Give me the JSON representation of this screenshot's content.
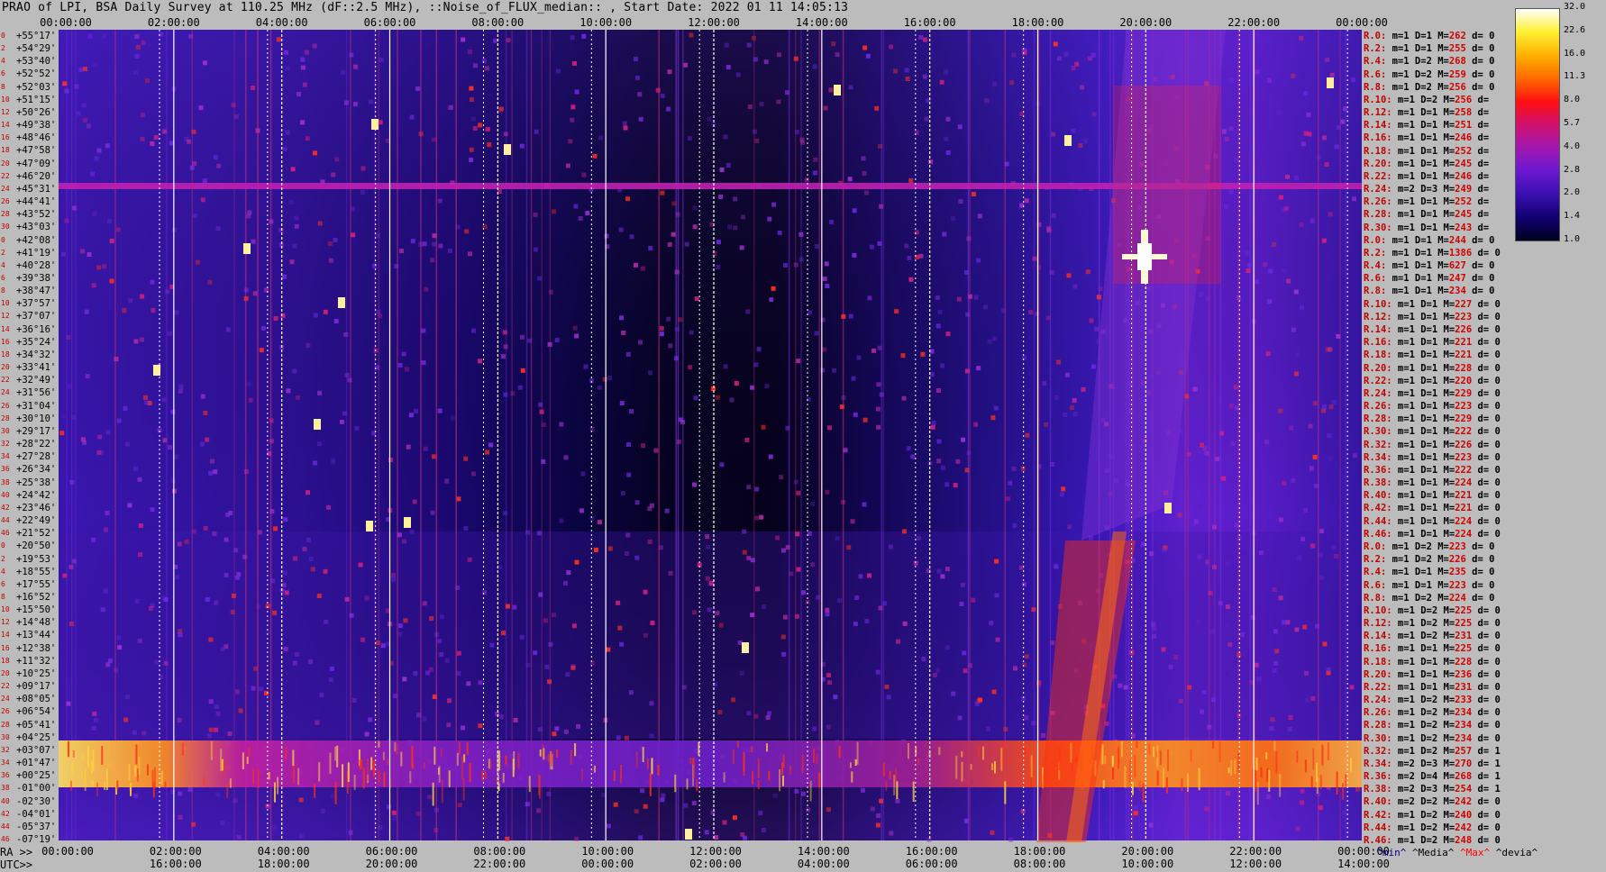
{
  "title": "PRAO of LPI, BSA Daily Survey at 110.25 MHz (dF::2.5 MHz), ::Noise_of_FLUX_median:: , Start Date: 2022 01 11 14:05:13",
  "chart_data": {
    "type": "heatmap",
    "title": "PRAO of LPI, BSA Daily Survey at 110.25 MHz (dF::2.5 MHz), ::Noise_of_FLUX_median:: , Start Date: 2022 01 11 14:05:13",
    "x_top_ticks": [
      "00:00:00",
      "02:00:00",
      "04:00:00",
      "06:00:00",
      "08:00:00",
      "10:00:00",
      "12:00:00",
      "14:00:00",
      "16:00:00",
      "18:00:00",
      "20:00:00",
      "22:00:00",
      "00:00:00"
    ],
    "x_ra_ticks": [
      "00:00:00",
      "02:00:00",
      "04:00:00",
      "06:00:00",
      "08:00:00",
      "10:00:00",
      "12:00:00",
      "14:00:00",
      "16:00:00",
      "18:00:00",
      "20:00:00",
      "22:00:00",
      "00:00:00"
    ],
    "x_utc_ticks": [
      "16:00:00",
      "18:00:00",
      "20:00:00",
      "22:00:00",
      "00:00:00",
      "02:00:00",
      "04:00:00",
      "06:00:00",
      "08:00:00",
      "10:00:00",
      "12:00:00",
      "14:00:00"
    ],
    "ra_axis_label": "RA >>",
    "utc_axis_label": "UTC>>",
    "colorbar": {
      "ticks": [
        "32.0",
        "22.6",
        "16.0",
        "11.3",
        "8.0",
        "5.7",
        "4.0",
        "2.8",
        "2.0",
        "1.4",
        "1.0"
      ],
      "scale": "log2"
    },
    "declinations": [
      "+55°17'",
      "+54°29'",
      "+53°40'",
      "+52°52'",
      "+52°03'",
      "+51°15'",
      "+50°26'",
      "+49°38'",
      "+48°46'",
      "+47°58'",
      "+47°09'",
      "+46°20'",
      "+45°31'",
      "+44°41'",
      "+43°52'",
      "+43°03'",
      "+42°08'",
      "+41°19'",
      "+40°28'",
      "+39°38'",
      "+38°47'",
      "+37°57'",
      "+37°07'",
      "+36°16'",
      "+35°24'",
      "+34°32'",
      "+33°41'",
      "+32°49'",
      "+31°56'",
      "+31°04'",
      "+30°10'",
      "+29°17'",
      "+28°22'",
      "+27°28'",
      "+26°34'",
      "+25°38'",
      "+24°42'",
      "+23°46'",
      "+22°49'",
      "+21°52'",
      "+20°50'",
      "+19°53'",
      "+18°55'",
      "+17°55'",
      "+16°52'",
      "+15°50'",
      "+14°48'",
      "+13°44'",
      "+12°38'",
      "+11°32'",
      "+10°25'",
      "+09°17'",
      "+08°05'",
      "+06°54'",
      "+05°41'",
      "+04°25'",
      "+03°07'",
      "+01°47'",
      "+00°25'",
      "-01°00'",
      "-02°30'",
      "-04°01'",
      "-05°37'",
      "-07°19'"
    ],
    "row_index": [
      "0",
      "2",
      "4",
      "6",
      "8",
      "10",
      "12",
      "14",
      "16",
      "18",
      "20",
      "22",
      "24",
      "26",
      "28",
      "30",
      "0",
      "2",
      "4",
      "6",
      "8",
      "10",
      "12",
      "14",
      "16",
      "18",
      "20",
      "22",
      "24",
      "26",
      "28",
      "30",
      "32",
      "34",
      "36",
      "38",
      "40",
      "42",
      "44",
      "46",
      "0",
      "2",
      "4",
      "6",
      "8",
      "10",
      "12",
      "14",
      "16",
      "18",
      "20",
      "22",
      "24",
      "26",
      "28",
      "30",
      "32",
      "34",
      "36",
      "38",
      "40",
      "42",
      "44",
      "46"
    ],
    "receivers": [
      [
        "R.0:",
        "1",
        "1",
        "262",
        "0"
      ],
      [
        "R.2:",
        "1",
        "1",
        "255",
        "0"
      ],
      [
        "R.4:",
        "1",
        "2",
        "268",
        "0"
      ],
      [
        "R.6:",
        "1",
        "2",
        "259",
        "0"
      ],
      [
        "R.8:",
        "1",
        "2",
        "256",
        "0"
      ],
      [
        "R.10:",
        "1",
        "2",
        "256",
        ""
      ],
      [
        "R.12:",
        "1",
        "1",
        "258",
        ""
      ],
      [
        "R.14:",
        "1",
        "1",
        "251",
        ""
      ],
      [
        "R.16:",
        "1",
        "1",
        "246",
        ""
      ],
      [
        "R.18:",
        "1",
        "1",
        "252",
        ""
      ],
      [
        "R.20:",
        "1",
        "1",
        "245",
        ""
      ],
      [
        "R.22:",
        "1",
        "1",
        "246",
        ""
      ],
      [
        "R.24:",
        "2",
        "3",
        "249",
        ""
      ],
      [
        "R.26:",
        "1",
        "1",
        "252",
        ""
      ],
      [
        "R.28:",
        "1",
        "1",
        "245",
        ""
      ],
      [
        "R.30:",
        "1",
        "1",
        "243",
        ""
      ],
      [
        "R.0:",
        "1",
        "1",
        "244",
        "0"
      ],
      [
        "R.2:",
        "1",
        "1",
        "1386",
        "0"
      ],
      [
        "R.4:",
        "1",
        "1",
        "627",
        "0"
      ],
      [
        "R.6:",
        "1",
        "1",
        "247",
        "0"
      ],
      [
        "R.8:",
        "1",
        "1",
        "234",
        "0"
      ],
      [
        "R.10:",
        "1",
        "1",
        "227",
        "0"
      ],
      [
        "R.12:",
        "1",
        "1",
        "223",
        "0"
      ],
      [
        "R.14:",
        "1",
        "1",
        "226",
        "0"
      ],
      [
        "R.16:",
        "1",
        "1",
        "221",
        "0"
      ],
      [
        "R.18:",
        "1",
        "1",
        "221",
        "0"
      ],
      [
        "R.20:",
        "1",
        "1",
        "228",
        "0"
      ],
      [
        "R.22:",
        "1",
        "1",
        "220",
        "0"
      ],
      [
        "R.24:",
        "1",
        "1",
        "229",
        "0"
      ],
      [
        "R.26:",
        "1",
        "1",
        "223",
        "0"
      ],
      [
        "R.28:",
        "1",
        "1",
        "229",
        "0"
      ],
      [
        "R.30:",
        "1",
        "1",
        "222",
        "0"
      ],
      [
        "R.32:",
        "1",
        "1",
        "226",
        "0"
      ],
      [
        "R.34:",
        "1",
        "1",
        "223",
        "0"
      ],
      [
        "R.36:",
        "1",
        "1",
        "222",
        "0"
      ],
      [
        "R.38:",
        "1",
        "1",
        "224",
        "0"
      ],
      [
        "R.40:",
        "1",
        "1",
        "221",
        "0"
      ],
      [
        "R.42:",
        "1",
        "1",
        "221",
        "0"
      ],
      [
        "R.44:",
        "1",
        "1",
        "224",
        "0"
      ],
      [
        "R.46:",
        "1",
        "1",
        "224",
        "0"
      ],
      [
        "R.0:",
        "1",
        "2",
        "223",
        "0"
      ],
      [
        "R.2:",
        "1",
        "2",
        "226",
        "0"
      ],
      [
        "R.4:",
        "1",
        "1",
        "235",
        "0"
      ],
      [
        "R.6:",
        "1",
        "1",
        "223",
        "0"
      ],
      [
        "R.8:",
        "1",
        "2",
        "224",
        "0"
      ],
      [
        "R.10:",
        "1",
        "2",
        "225",
        "0"
      ],
      [
        "R.12:",
        "1",
        "2",
        "225",
        "0"
      ],
      [
        "R.14:",
        "1",
        "2",
        "231",
        "0"
      ],
      [
        "R.16:",
        "1",
        "1",
        "225",
        "0"
      ],
      [
        "R.18:",
        "1",
        "1",
        "228",
        "0"
      ],
      [
        "R.20:",
        "1",
        "1",
        "236",
        "0"
      ],
      [
        "R.22:",
        "1",
        "1",
        "231",
        "0"
      ],
      [
        "R.24:",
        "1",
        "2",
        "233",
        "0"
      ],
      [
        "R.26:",
        "1",
        "2",
        "234",
        "0"
      ],
      [
        "R.28:",
        "1",
        "2",
        "234",
        "0"
      ],
      [
        "R.30:",
        "1",
        "2",
        "234",
        "0"
      ],
      [
        "R.32:",
        "1",
        "2",
        "257",
        "1"
      ],
      [
        "R.34:",
        "2",
        "3",
        "270",
        "1"
      ],
      [
        "R.36:",
        "2",
        "4",
        "268",
        "1"
      ],
      [
        "R.38:",
        "2",
        "3",
        "254",
        "1"
      ],
      [
        "R.40:",
        "2",
        "2",
        "242",
        "0"
      ],
      [
        "R.42:",
        "1",
        "2",
        "240",
        "0"
      ],
      [
        "R.44:",
        "1",
        "2",
        "242",
        "0"
      ],
      [
        "R.46:",
        "1",
        "2",
        "248",
        "0"
      ]
    ],
    "legend": {
      "min": "^min^",
      "median": "^Media^",
      "max": "^Max^",
      "dev": "^devia^"
    },
    "colors": {
      "min": "#000080",
      "median": "#000000",
      "max": "#ff0000",
      "dev": "#000000"
    }
  }
}
